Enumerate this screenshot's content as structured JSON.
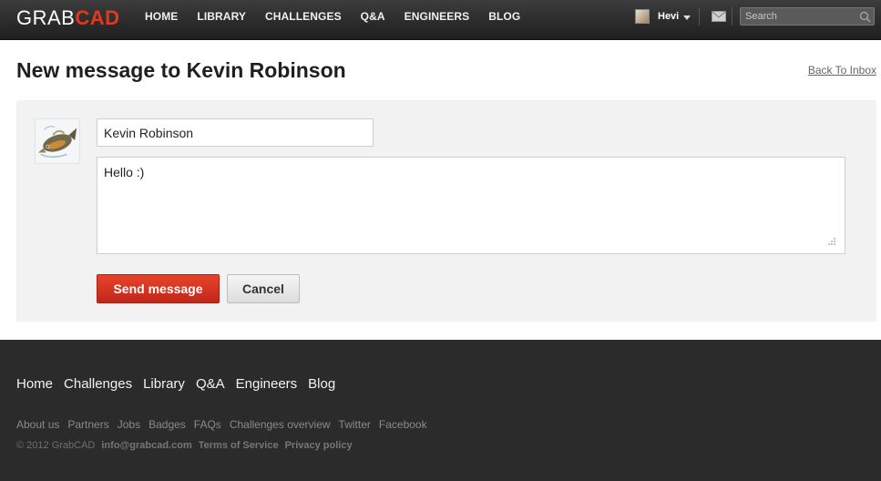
{
  "header": {
    "logo_primary": "GRAB",
    "logo_accent": "CAD",
    "nav": [
      "HOME",
      "LIBRARY",
      "CHALLENGES",
      "Q&A",
      "ENGINEERS",
      "BLOG"
    ],
    "user_name": "Hevi",
    "search_placeholder": "Search",
    "icons": [
      "user-avatar",
      "chevron-down-icon",
      "mail-icon",
      "search-icon"
    ]
  },
  "page": {
    "title": "New message to Kevin Robinson",
    "back_link": "Back To Inbox"
  },
  "compose": {
    "to_value": "Kevin Robinson",
    "message_value": "Hello :)",
    "send_label": "Send message",
    "cancel_label": "Cancel"
  },
  "footer": {
    "main_links": [
      "Home",
      "Challenges",
      "Library",
      "Q&A",
      "Engineers",
      "Blog"
    ],
    "sub_links": [
      "About us",
      "Partners",
      "Jobs",
      "Badges",
      "FAQs",
      "Challenges overview",
      "Twitter",
      "Facebook"
    ],
    "copyright": "© 2012 GrabCAD",
    "email": "info@grabcad.com",
    "terms": "Terms of Service",
    "privacy": "Privacy policy"
  },
  "colors": {
    "accent": "#e03a1e",
    "topbar": "#2b2b2b",
    "footer": "#2b2b2b"
  }
}
